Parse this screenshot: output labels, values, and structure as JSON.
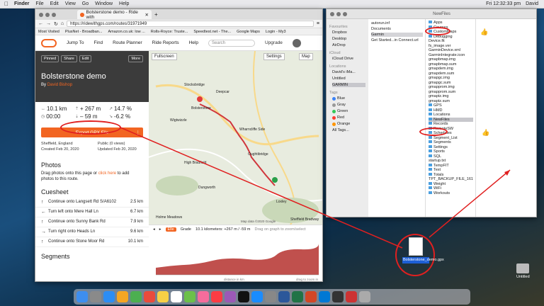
{
  "menubar": {
    "app": "Finder",
    "items": [
      "File",
      "Edit",
      "View",
      "Go",
      "Window",
      "Help"
    ],
    "clock": "Fri 12:32:33 pm",
    "user": "David"
  },
  "browser": {
    "tab_title": "Bolsterstone demo - Ride with",
    "url": "https://ridewithgps.com/routes/31971949",
    "bookmarks": [
      "Most Visited",
      "PlusNet - Broadban...",
      "Amazon.co.uk: low ...",
      "Rolls-Royce: Truste...",
      "Speedtest.net - The...",
      "Google Maps",
      "Login - My3"
    ],
    "nav": {
      "jump": "Jump To",
      "find": "Find",
      "planner": "Route Planner",
      "reports": "Ride Reports",
      "help": "Help",
      "search_placeholder": "Search",
      "upgrade": "Upgrade"
    }
  },
  "route": {
    "buttons": {
      "pinned": "Pinned",
      "share": "Share",
      "edit": "Edit",
      "more": "More"
    },
    "title": "Bolsterstone demo",
    "by": "By",
    "author": "David Bishop",
    "stats": {
      "distance": "10.1 km",
      "gain": "+ 267 m",
      "grade_up": "14.7 %",
      "time": "00:00",
      "loss": "– 59 m",
      "grade_down": "-6.2 %"
    },
    "export": "Export GPX File",
    "meta": {
      "location": "Sheffield, England",
      "visibility": "Public (0 views)",
      "created": "Created Feb 20, 2020",
      "updated": "Updated Feb 20, 2020"
    },
    "photos_heading": "Photos",
    "photos_text_1": "Drag photos onto this page or ",
    "photos_link": "click here",
    "photos_text_2": " to add photos to this route.",
    "cuesheet_heading": "Cuesheet",
    "cues": [
      {
        "text": "Continue onto Langsett Rd S/A6102",
        "dist": "2.5 km"
      },
      {
        "text": "Turn left onto Mere Hall Ln",
        "dist": "6.7 km"
      },
      {
        "text": "Continue onto Sunny Bank Rd",
        "dist": "7.9 km"
      },
      {
        "text": "Turn right onto Heads Ln",
        "dist": "9.6 km"
      },
      {
        "text": "Continue onto Stone Moor Rd",
        "dist": "10.1 km"
      }
    ],
    "segments_heading": "Segments"
  },
  "map": {
    "fullscreen": "Fullscreen",
    "settings": "Settings",
    "maptype": "Map",
    "labels": [
      "Bolsterstone",
      "Stocksbridge",
      "Deepcar",
      "Wharncliffe Side",
      "Oughtibridge",
      "High Bradfield",
      "Dungworth",
      "Loxley",
      "Sheffield Bradway",
      "Holme Meadows",
      "Wigtwizzle"
    ],
    "attribution": "Map data ©2020 Google"
  },
  "elevation": {
    "tab_elev": "Elle",
    "tab_grade": "Grade",
    "summary": "10.1 kilometers: +267 m / -59 m",
    "hint": "Drag on graph to zoom/select",
    "xlabel": "distance in km",
    "hint2": "drag to zoom in"
  },
  "finder": {
    "title": "NewFiles",
    "sidebar": {
      "favourites": "Favourites",
      "fav_items": [
        "Dropbox",
        "Desktop",
        "AirDrop"
      ],
      "icloud": "iCloud",
      "icloud_items": [
        "iCloud Drive"
      ],
      "locations": "Locations",
      "loc_items": [
        "David's iMa...",
        "Untitled",
        "GARMIN"
      ],
      "tags": "Tags",
      "tag_items": [
        "Blue",
        "Gray",
        "Green",
        "Red",
        "Orange",
        "All Tags..."
      ]
    },
    "col1": [
      "autorun.inf",
      "Documents",
      "Garmin",
      "Get Started...in Connect.url"
    ],
    "col2": [
      "Apps",
      "Courses",
      "CustomMaps",
      "Debugging",
      "Device.fit",
      "fs_image.ver",
      "GarminDevice.xml",
      "GarminIntegrate.icon",
      "gmapbmap.img",
      "gmapbmap.sum",
      "gmapdem.img",
      "gmapdem.sum",
      "gmapgc.img",
      "gmapgc.sum",
      "gmapprom.img",
      "gmapprom.sum",
      "gmaptz.img",
      "gmaptz.sum",
      "GPS",
      "HMD",
      "Locations",
      "NewFiles",
      "Records",
      "RemoteSW",
      "Schedules",
      "Segment_List",
      "Segments",
      "Settings",
      "Sports",
      "SQL",
      "startup.txt",
      "TempFIT",
      "Text",
      "Totals",
      "TPT_BACKUP_FILE_161.bak",
      "Weight",
      "WiFi",
      "Workouts"
    ]
  },
  "desktop": {
    "file_label": "Bolsterstone_demo.gpx",
    "disk_label": "Untitled"
  }
}
